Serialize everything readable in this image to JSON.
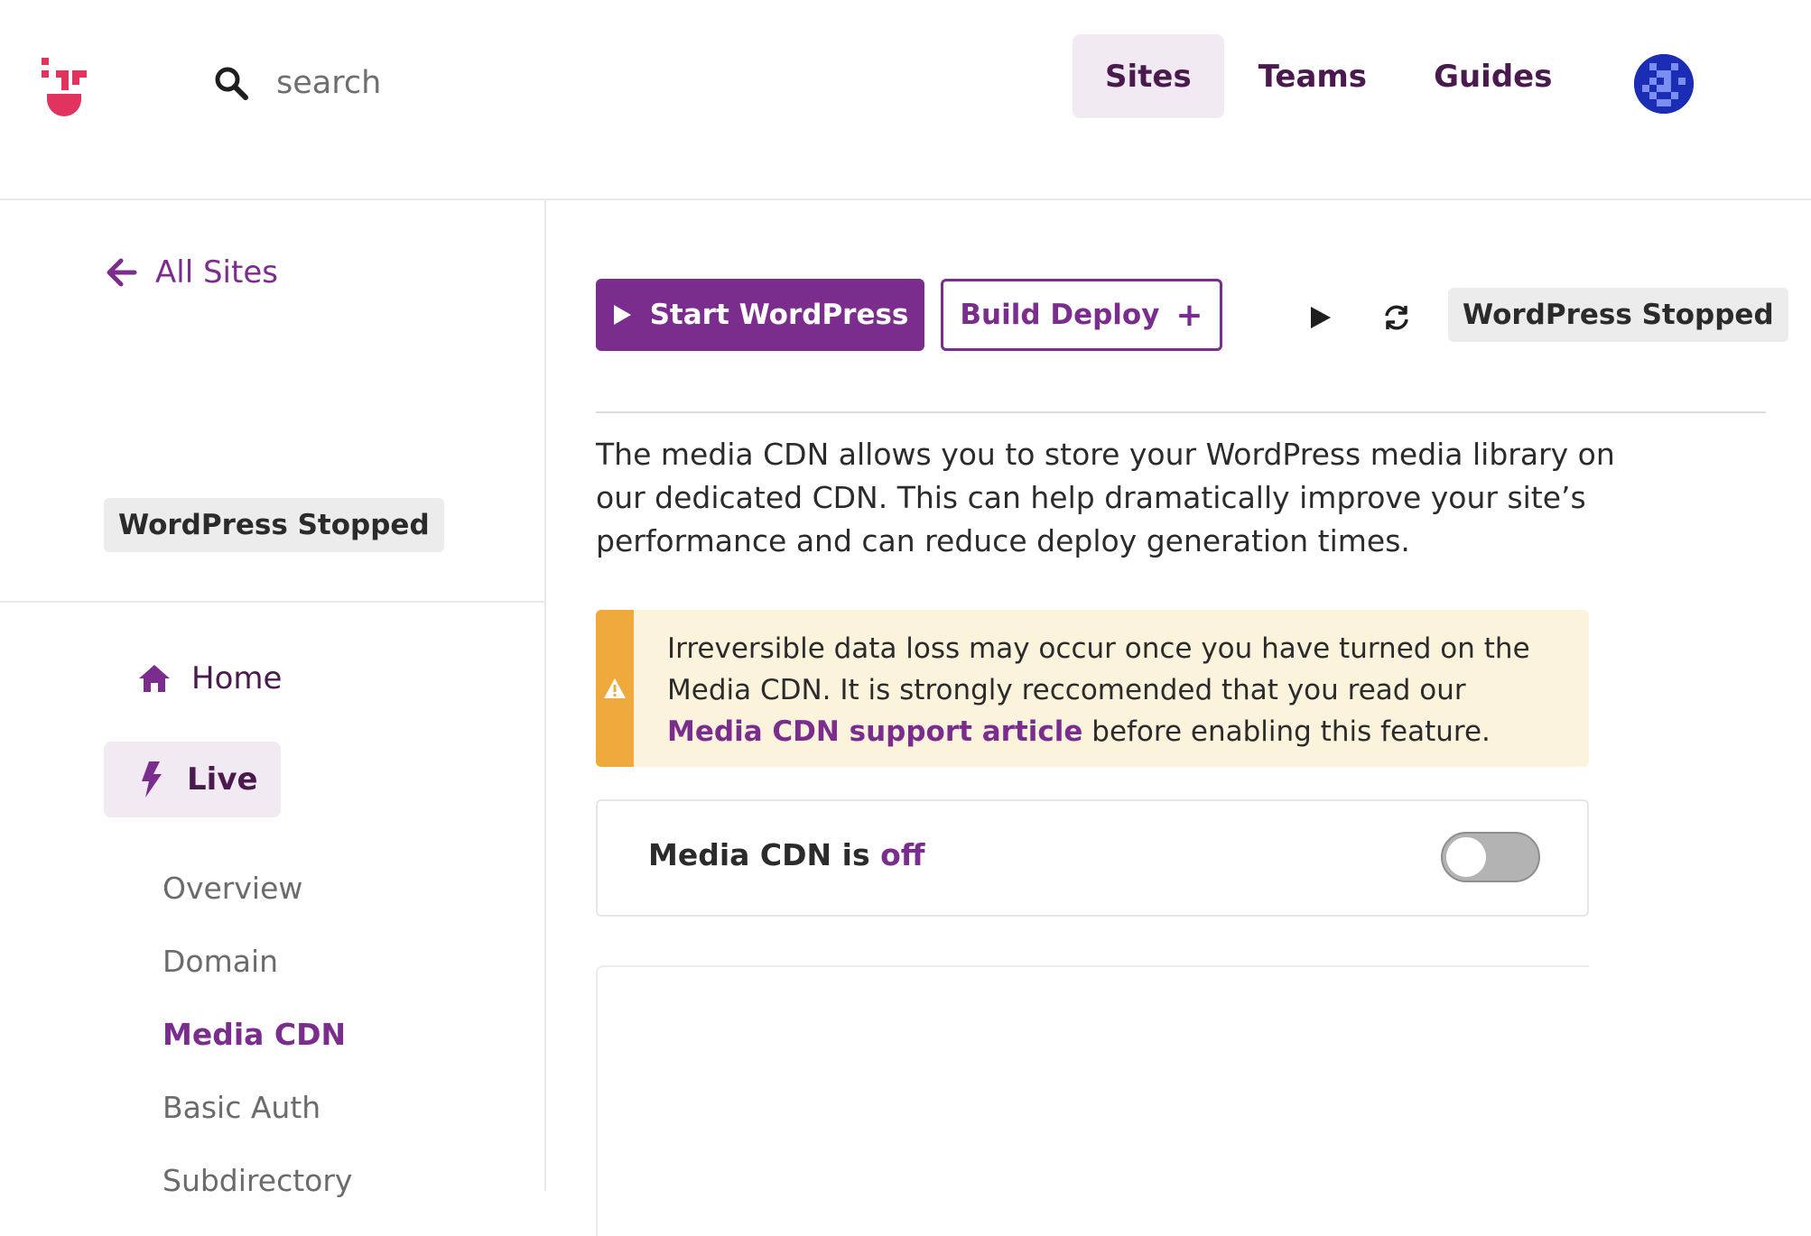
{
  "header": {
    "search_placeholder": "search",
    "nav": [
      {
        "label": "Sites",
        "active": true
      },
      {
        "label": "Teams",
        "active": false
      },
      {
        "label": "Guides",
        "active": false
      }
    ]
  },
  "sidebar": {
    "back_label": "All Sites",
    "status": "WordPress Stopped",
    "home_label": "Home",
    "live_label": "Live",
    "subnav": [
      {
        "label": "Overview",
        "active": false
      },
      {
        "label": "Domain",
        "active": false
      },
      {
        "label": "Media CDN",
        "active": true
      },
      {
        "label": "Basic Auth",
        "active": false
      },
      {
        "label": "Subdirectory",
        "active": false
      }
    ]
  },
  "toolbar": {
    "start_label": "Start WordPress",
    "build_label": "Build Deploy",
    "build_plus": "+",
    "status": "WordPress Stopped"
  },
  "content": {
    "description": "The media CDN allows you to store your WordPress media library on our dedicated CDN. This can help dramatically improve your site’s performance and can reduce deploy generation times.",
    "warning_before": "Irreversible data loss may occur once you have turned on the Media CDN. It is strongly reccomended that you read our ",
    "warning_link": "Media CDN support article",
    "warning_after": " before enabling this feature.",
    "cdn_label": "Media CDN is ",
    "cdn_state": "off",
    "cdn_enabled": false
  },
  "colors": {
    "brand": "#7b2d8e",
    "nav_text": "#4a1a4f",
    "warning_stripe": "#f0a93c",
    "warning_bg": "#fbf3dc",
    "logo": "#e0335e"
  },
  "icons": [
    "logo-icon",
    "search-icon",
    "avatar",
    "arrow-left-icon",
    "home-icon",
    "bolt-icon",
    "play-icon",
    "refresh-icon",
    "warning-icon"
  ]
}
